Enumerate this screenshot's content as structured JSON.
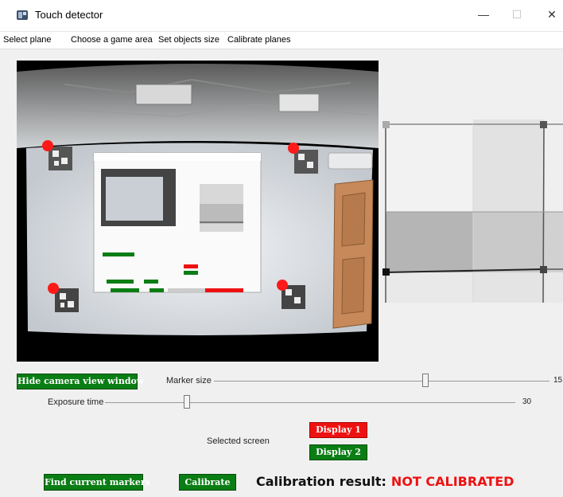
{
  "window": {
    "title": "Touch detector",
    "minimize": "—",
    "maximize": "☐",
    "close": "✕"
  },
  "menu": [
    "Select plane",
    "Choose a game area",
    "Set objects size",
    "Calibrate planes"
  ],
  "controls": {
    "hide_camera_button": "Hide camera view window",
    "marker_size_label": "Marker size",
    "marker_size_value": "15",
    "marker_size_fraction": 0.63,
    "exposure_label": "Exposure time",
    "exposure_value": "30",
    "exposure_fraction": 0.2,
    "selected_screen_label": "Selected screen",
    "display1_button": "Display 1",
    "display2_button": "Display 2",
    "find_markers_button": "Find current markers",
    "calibrate_button": "Calibrate",
    "calibration_result_label": "Calibration result:",
    "calibration_status": "NOT CALIBRATED"
  },
  "icons": [
    "app-icon",
    "minimize-icon",
    "maximize-icon",
    "close-icon"
  ],
  "colors": {
    "green_button": "#0a7d14",
    "red_button": "#ee1111",
    "status_red": "#ee1111",
    "marker_dot": "#ff1a1a"
  }
}
